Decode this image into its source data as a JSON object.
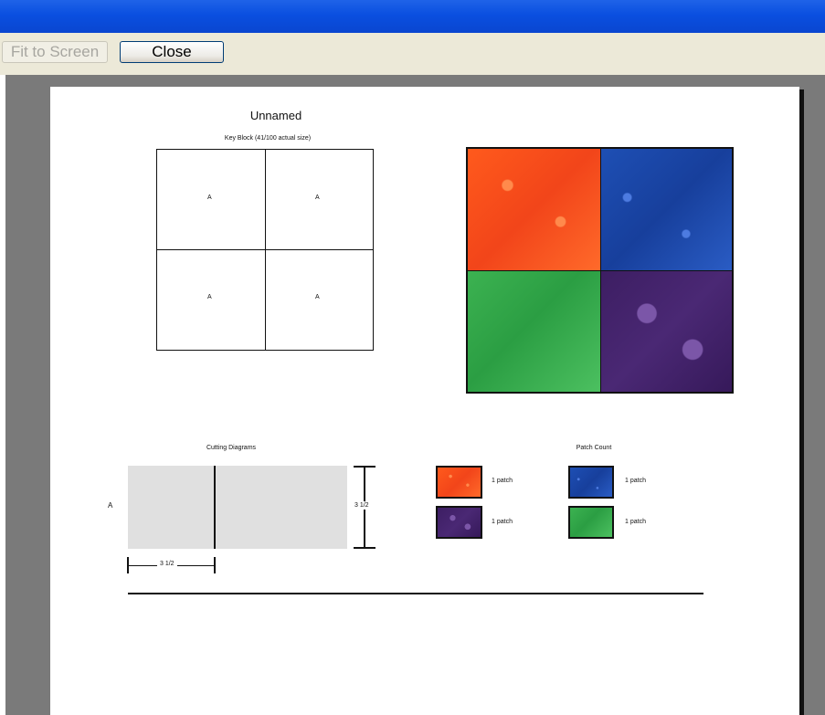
{
  "toolbar": {
    "fit_label": "Fit to Screen",
    "close_label": "Close"
  },
  "page": {
    "title": "Unnamed",
    "key_block_caption": "Key Block  (41/100 actual size)",
    "key_block_cells": [
      "A",
      "A",
      "A",
      "A"
    ],
    "cutting": {
      "title": "Cutting Diagrams",
      "row_label": "A",
      "height_label": "3 1/2",
      "width_label": "3 1/2"
    },
    "patch_count": {
      "title": "Patch Count",
      "items": [
        {
          "fabric": "orange",
          "label": "1 patch"
        },
        {
          "fabric": "blue",
          "label": "1 patch"
        },
        {
          "fabric": "purple",
          "label": "1 patch"
        },
        {
          "fabric": "green",
          "label": "1 patch"
        }
      ]
    }
  },
  "colors": {
    "titlebar": "#0a4fe0",
    "orange_fabric": "#f2451a",
    "blue_fabric": "#173f9c",
    "green_fabric": "#2b9e43",
    "purple_fabric": "#4a2874",
    "cut_fill": "#e0e0e0"
  }
}
